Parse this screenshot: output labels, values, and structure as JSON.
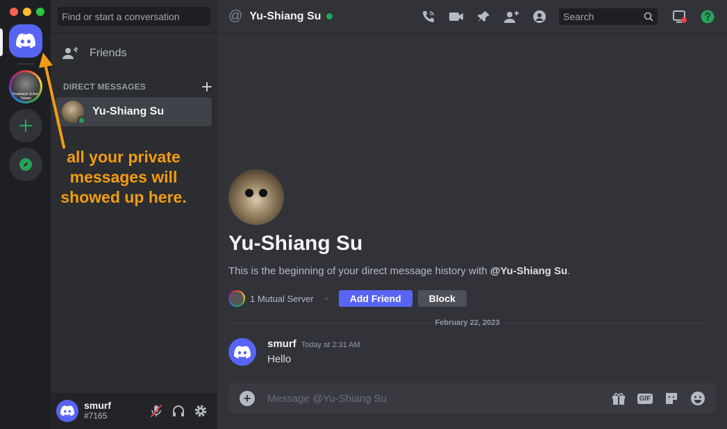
{
  "sidebar": {
    "search_placeholder": "Find or start a conversation",
    "friends_label": "Friends",
    "dm_section_title": "DIRECT MESSAGES",
    "dm_items": [
      {
        "name": "Yu-Shiang Su",
        "status": "online"
      }
    ],
    "user": {
      "name": "smurf",
      "tag": "#7165"
    }
  },
  "rail": {
    "server_badge_line1": "Breakhack School",
    "server_badge_line2": "Taiwan"
  },
  "annotation": {
    "text": "all your private messages will showed up here.",
    "color": "#f39c12"
  },
  "topbar": {
    "title": "Yu-Shiang Su",
    "search_placeholder": "Search"
  },
  "intro": {
    "name": "Yu-Shiang Su",
    "desc_prefix": "This is the beginning of your direct message history with ",
    "desc_mention": "@Yu-Shiang Su",
    "desc_suffix": ".",
    "mutual": "1 Mutual Server",
    "add_friend": "Add Friend",
    "block": "Block"
  },
  "date_divider": "February 22, 2023",
  "messages": [
    {
      "author": "smurf",
      "time": "Today at 2:31 AM",
      "text": "Hello"
    }
  ],
  "composer": {
    "placeholder": "Message @Yu-Shiang Su",
    "gif_label": "GIF"
  },
  "colors": {
    "blurple": "#5865f2",
    "online": "#23a559"
  }
}
